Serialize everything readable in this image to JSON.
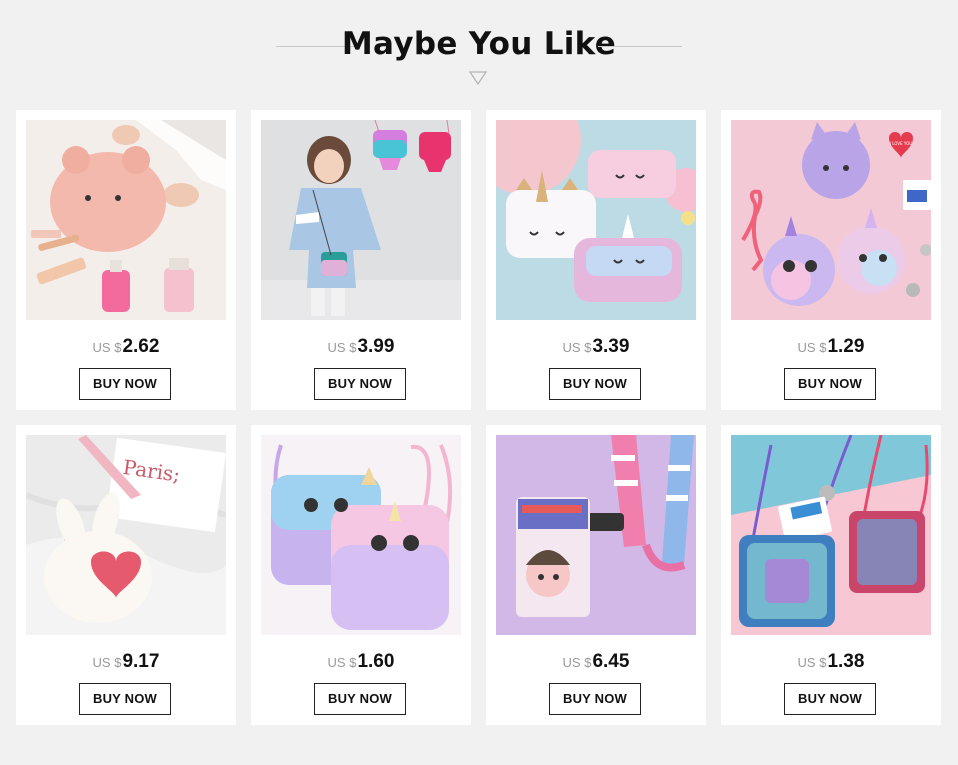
{
  "header": {
    "title": "Maybe You Like"
  },
  "products": [
    {
      "currency": "US $",
      "price": "2.62",
      "button": "BUY NOW",
      "image": "pink-sheep-plush-pouch",
      "img_text": ""
    },
    {
      "currency": "US $",
      "price": "3.99",
      "button": "BUY NOW",
      "image": "girl-with-sequin-crossbody-bag",
      "img_text": ""
    },
    {
      "currency": "US $",
      "price": "3.39",
      "button": "BUY NOW",
      "image": "unicorn-plush-pencil-cases",
      "img_text": ""
    },
    {
      "currency": "US $",
      "price": "1.29",
      "button": "BUY NOW",
      "image": "rainbow-cat-coin-purses",
      "img_text": "I LOVE YOU"
    },
    {
      "currency": "US $",
      "price": "9.17",
      "button": "BUY NOW",
      "image": "white-bunny-heart-bag",
      "img_text": "Paris;"
    },
    {
      "currency": "US $",
      "price": "1.60",
      "button": "BUY NOW",
      "image": "rainbow-unicorn-phone-bags",
      "img_text": ""
    },
    {
      "currency": "US $",
      "price": "6.45",
      "button": "BUY NOW",
      "image": "cartoon-card-holder-lanyard",
      "img_text": ""
    },
    {
      "currency": "US $",
      "price": "1.38",
      "button": "BUY NOW",
      "image": "sequin-square-coin-bags",
      "img_text": ""
    }
  ],
  "colors": {
    "background": "#f1f1f1",
    "card": "#ffffff",
    "button_border": "#222222",
    "price_currency": "#999999",
    "price_amount": "#111111"
  }
}
